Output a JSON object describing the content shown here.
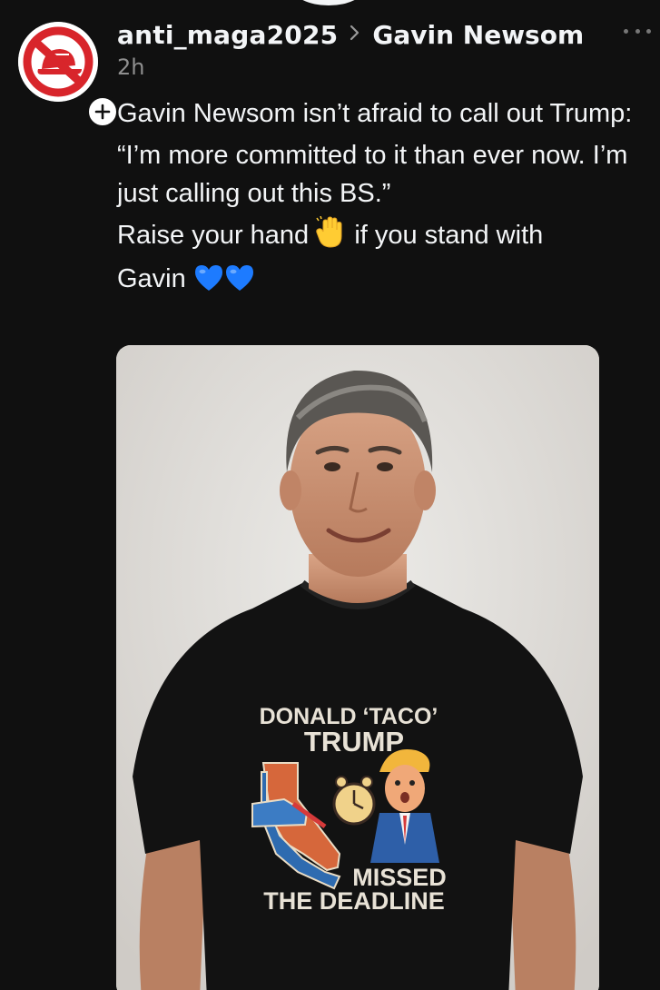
{
  "post": {
    "username": "anti_maga2025",
    "community": "Gavin Newsom",
    "time": "2h",
    "lines": [
      "Gavin Newsom isn’t afraid to call out Trump:",
      "“I’m more committed to it than ever now. I’m just calling out this BS.”"
    ],
    "raise_prefix": "Raise your hand",
    "raise_suffix": "if you stand with",
    "raise_end": "Gavin"
  },
  "shirt": {
    "line1": "DONALD ‘TACO’",
    "line2": "TRUMP",
    "line3": "MISSED",
    "line4": "THE DEADLINE"
  },
  "colors": {
    "background": "#101010",
    "text": "#f3f5f7",
    "muted": "#8f8f8f",
    "avatar_red": "#d8252b",
    "heart_blue": "#1d7bff"
  },
  "icons": {
    "avatar": "no-maga-hat-icon",
    "follow": "plus-icon",
    "more": "more-dots-icon",
    "chevron": "chevron-right-icon",
    "hand": "raised-hand-emoji",
    "heart": "blue-heart-emoji"
  }
}
